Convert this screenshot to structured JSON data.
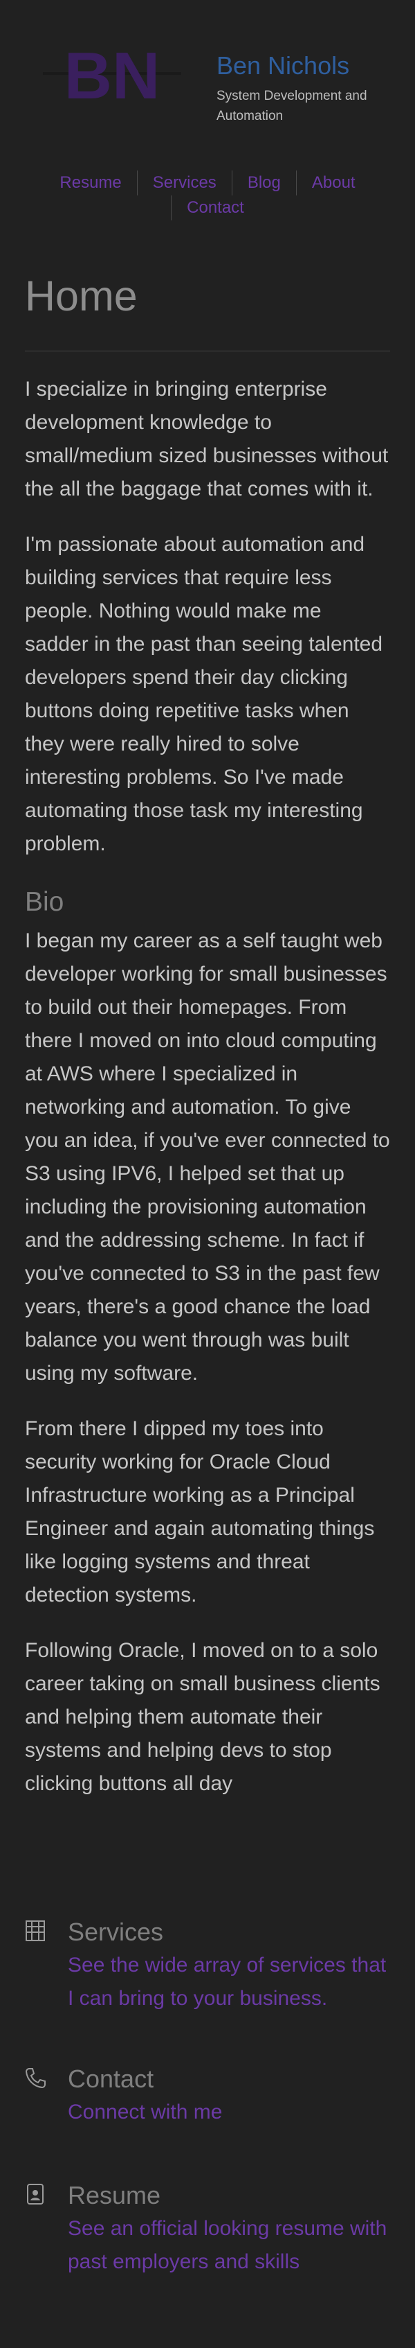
{
  "site": {
    "name": "Ben Nichols",
    "tagline": "System Development and Automation",
    "logo_initials": "BN"
  },
  "nav": [
    {
      "label": "Resume"
    },
    {
      "label": "Services"
    },
    {
      "label": "Blog"
    },
    {
      "label": "About"
    },
    {
      "label": "Contact"
    }
  ],
  "page": {
    "title": "Home",
    "intro": [
      "I specialize in bringing enterprise development knowledge to small/medium sized businesses without the all the baggage that comes with it.",
      "I'm passionate about automation and building services that require less people. Nothing would make me sadder in the past than seeing talented developers spend their day clicking buttons doing repetitive tasks when they were really hired to solve interesting problems. So I've made automating those task my interesting problem."
    ],
    "bio_heading": "Bio",
    "bio": [
      "I began my career as a self taught web developer working for small businesses to build out their homepages. From there I moved on into cloud computing at AWS where I specialized in networking and automation. To give you an idea, if you've ever connected to S3 using IPV6, I helped set that up including the provisioning automation and the addressing scheme. In fact if you've connected to S3 in the past few years, there's a good chance the load balance you went through was built using my software.",
      "From there I dipped my toes into security working for Oracle Cloud Infrastructure working as a Principal Engineer and again automating things like logging systems and threat detection systems.",
      "Following Oracle, I moved on to a solo career taking on small business clients and helping them automate their systems and helping devs to stop clicking buttons all day"
    ]
  },
  "cards": [
    {
      "icon": "building-icon",
      "title": "Services",
      "link": "See the wide array of services that I can bring to your business."
    },
    {
      "icon": "phone-icon",
      "title": "Contact",
      "link": "Connect with me"
    },
    {
      "icon": "id-badge-icon",
      "title": "Resume",
      "link": "See an official looking resume with past employers and skills"
    }
  ],
  "colors": {
    "background": "#212121",
    "accent_link": "#6b3aa6",
    "title_blue": "#2f5f9f"
  }
}
